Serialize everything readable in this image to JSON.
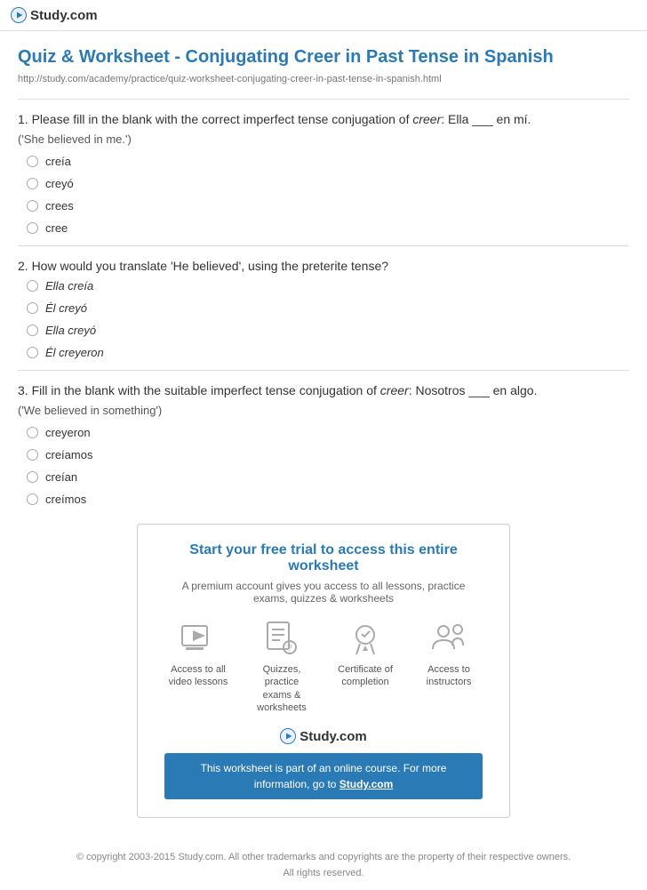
{
  "header": {
    "logo_text": "Study.com",
    "logo_icon": "play-circle"
  },
  "page": {
    "title": "Quiz & Worksheet - Conjugating Creer in Past Tense in Spanish",
    "url": "http://study.com/academy/practice/quiz-worksheet-conjugating-creer-in-past-tense-in-spanish.html"
  },
  "questions": [
    {
      "id": "1",
      "text_prefix": "1. Please fill in the blank with the correct imperfect tense conjugation of ",
      "text_italic": "creer",
      "text_suffix": ": Ella ___ en mí.",
      "subtext": "('She believed in me.')",
      "options": [
        "creía",
        "creyó",
        "crees",
        "cree"
      ]
    },
    {
      "id": "2",
      "text_prefix": "2. How would you translate 'He believed', using the preterite tense?",
      "text_italic": "",
      "text_suffix": "",
      "subtext": "",
      "options": [
        "Ella creía",
        "Él creyó",
        "Ella creyó",
        "Él creyeron"
      ]
    },
    {
      "id": "3",
      "text_prefix": "3. Fill in the blank with the suitable imperfect tense conjugation of ",
      "text_italic": "creer",
      "text_suffix": ": Nosotros ___ en algo.",
      "subtext": "('We believed in something')",
      "options": [
        "creyeron",
        "creíamos",
        "creían",
        "creímos"
      ]
    }
  ],
  "cta": {
    "title": "Start your free trial to access this entire worksheet",
    "subtitle": "A premium account gives you access to all lessons, practice exams, quizzes & worksheets",
    "icons": [
      {
        "id": "video",
        "label": "Access to all\nvideo lessons"
      },
      {
        "id": "quiz",
        "label": "Quizzes, practice\nexams & worksheets"
      },
      {
        "id": "certificate",
        "label": "Certificate of\ncompletion"
      },
      {
        "id": "instructor",
        "label": "Access to\ninstructors"
      }
    ],
    "logo_text": "Study.com",
    "banner_text": "This worksheet is part of an online course. For more information, go to ",
    "banner_link_text": "Study.com",
    "banner_link_url": "#"
  },
  "footer": {
    "line1": "© copyright 2003-2015 Study.com. All other trademarks and copyrights are the property of their respective owners.",
    "line2": "All rights reserved."
  }
}
